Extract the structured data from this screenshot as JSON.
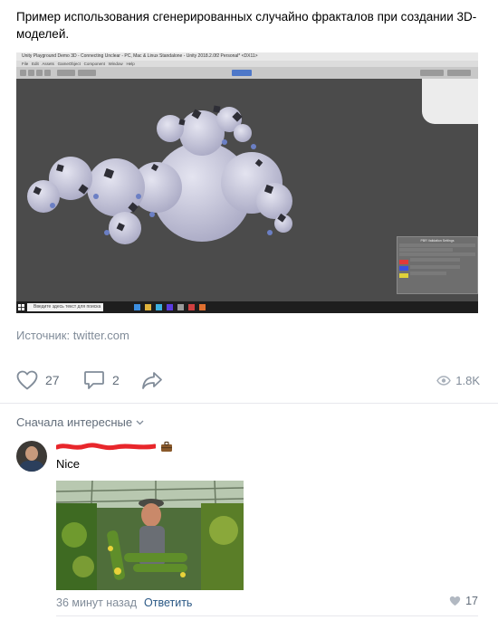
{
  "post": {
    "text": "Пример использования сгенерированных случайно фракталов при создании 3D-моделей.",
    "source": "Источник: twitter.com"
  },
  "video": {
    "window_title": "Unity Playground Demo 3D - Connecting Unclear - PC, Mac & Linux Standalone - Unity 2018.2.0f2 Personal* <DX11>",
    "menu": [
      "File",
      "Edit",
      "Assets",
      "GameObject",
      "Component",
      "Window",
      "Help"
    ],
    "taskbar_search": "Введите здесь текст для поиска",
    "panel_title": "PBR Validation Settings",
    "panel_swatch_colors": [
      "#e03a3a",
      "#3a4fe0",
      "#e0d23a"
    ],
    "scene_bg": "#4b4b4b",
    "fractal_color": "#c8c8dc"
  },
  "actions": {
    "likes": "27",
    "comments": "2",
    "views": "1.8K"
  },
  "comments": {
    "sort_label": "Сначала интересные",
    "items": [
      {
        "text": "Nice",
        "time": "36 минут назад",
        "reply_label": "Ответить",
        "likes": "17"
      }
    ]
  },
  "colors": {
    "accent_link": "#2a5885",
    "muted": "#818c99",
    "redacted_name": "#e8262b",
    "divider": "#e7e8ec"
  }
}
